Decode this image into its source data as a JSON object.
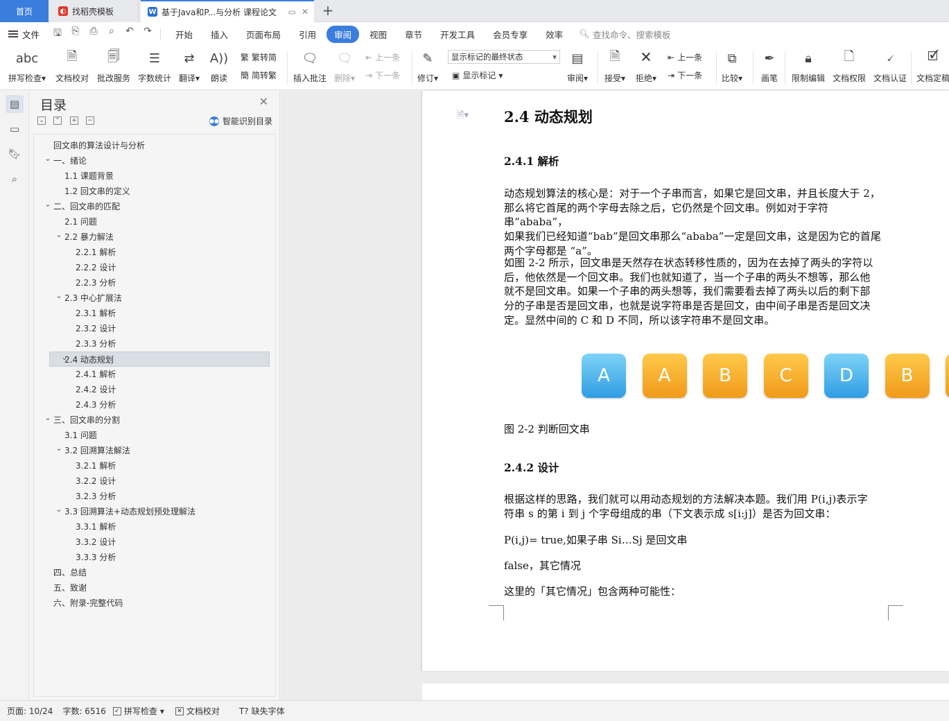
{
  "tabs": {
    "home": "首页",
    "templates": "找稻壳模板",
    "document": "基于Java和P...与分析 课程论文"
  },
  "menu": {
    "file": "文件",
    "items": [
      "开始",
      "插入",
      "页面布局",
      "引用",
      "审阅",
      "视图",
      "章节",
      "开发工具",
      "会员专享",
      "效率"
    ],
    "active": "审阅",
    "search": "查找命令、搜索模板"
  },
  "ribbon": {
    "spellcheck": "拼写检查",
    "doc_check": "文档校对",
    "revision_service": "批改服务",
    "word_count": "字数统计",
    "translate": "翻译",
    "read_aloud": "朗读",
    "to_traditional": "繁转简",
    "to_simplified": "简转繁",
    "insert_comment": "插入批注",
    "delete": "删除",
    "prev_comment": "上一条",
    "next_comment": "下一条",
    "track_changes": "修订",
    "markup_state": "显示标记的最终状态",
    "show_markup": "显示标记",
    "review": "审阅",
    "accept": "接受",
    "reject": "拒绝",
    "prev_change": "上一条",
    "next_change": "下一条",
    "compare": "比较",
    "pen": "画笔",
    "restrict_edit": "限制编辑",
    "doc_permission": "文档权限",
    "doc_certify": "文档认证",
    "doc_finalize": "文档定稿"
  },
  "toc": {
    "title": "目录",
    "smart": "智能识别目录",
    "items": [
      {
        "label": "回文串的算法设计与分析",
        "level": 0,
        "chev": false
      },
      {
        "label": "一、绪论",
        "level": 0,
        "chev": true
      },
      {
        "label": "1.1  课题背景",
        "level": 1,
        "chev": false
      },
      {
        "label": "1.2  回文串的定义",
        "level": 1,
        "chev": false
      },
      {
        "label": "二、回文串的匹配",
        "level": 0,
        "chev": true
      },
      {
        "label": "2.1  问题",
        "level": 1,
        "chev": false
      },
      {
        "label": "2.2  暴力解法",
        "level": 1,
        "chev": true
      },
      {
        "label": "2.2.1  解析",
        "level": 2,
        "chev": false
      },
      {
        "label": "2.2.2  设计",
        "level": 2,
        "chev": false
      },
      {
        "label": "2.2.3  分析",
        "level": 2,
        "chev": false
      },
      {
        "label": "2.3  中心扩展法",
        "level": 1,
        "chev": true
      },
      {
        "label": "2.3.1  解析",
        "level": 2,
        "chev": false
      },
      {
        "label": "2.3.2  设计",
        "level": 2,
        "chev": false
      },
      {
        "label": "2.3.3  分析",
        "level": 2,
        "chev": false
      },
      {
        "label": "2.4  动态规划",
        "level": 1,
        "chev": true,
        "selected": true
      },
      {
        "label": "2.4.1  解析",
        "level": 2,
        "chev": false
      },
      {
        "label": "2.4.2  设计",
        "level": 2,
        "chev": false
      },
      {
        "label": "2.4.3  分析",
        "level": 2,
        "chev": false
      },
      {
        "label": "三、回文串的分割",
        "level": 0,
        "chev": true
      },
      {
        "label": "3.1  问题",
        "level": 1,
        "chev": false
      },
      {
        "label": "3.2  回溯算法解法",
        "level": 1,
        "chev": true
      },
      {
        "label": "3.2.1  解析",
        "level": 2,
        "chev": false
      },
      {
        "label": "3.2.2  设计",
        "level": 2,
        "chev": false
      },
      {
        "label": "3.2.3  分析",
        "level": 2,
        "chev": false
      },
      {
        "label": "3.3  回溯算法+动态规划预处理解法",
        "level": 1,
        "chev": true
      },
      {
        "label": "3.3.1  解析",
        "level": 2,
        "chev": false
      },
      {
        "label": "3.3.2  设计",
        "level": 2,
        "chev": false
      },
      {
        "label": "3.3.3  分析",
        "level": 2,
        "chev": false
      },
      {
        "label": "四、总结",
        "level": 0,
        "chev": false
      },
      {
        "label": "五、致谢",
        "level": 0,
        "chev": false
      },
      {
        "label": "六、附录-完整代码",
        "level": 0,
        "chev": false
      }
    ]
  },
  "document": {
    "h24": "2.4  动态规划",
    "h241": "2.4.1  解析",
    "p1": [
      "动态规划算法的核心是：对于一个子串而言，如果它是回文串，并且长度大于 2，",
      "那么将它首尾的两个字母去除之后，它仍然是个回文串。例如对于字符串“ababa”，",
      "如果我们已经知道“bab”是回文串那么“ababa”一定是回文串，这是因为它的首尾",
      "两个字母都是 “a”。"
    ],
    "p2": [
      "如图 2-2 所示，回文串是天然存在状态转移性质的，因为在去掉了两头的字符以",
      "后，他依然是一个回文串。我们也就知道了，当一个子串的两头不想等，那么他",
      "就不是回文串。如果一个子串的两头想等，我们需要看去掉了两头以后的剩下部",
      "分的子串是否是回文串，也就是说字符串是否是回文，由中间子串是否是回文决",
      "定。显然中间的 C 和 D 不同，所以该字符串不是回文串。"
    ],
    "letters": [
      {
        "ch": "A",
        "color": "blue"
      },
      {
        "ch": "A",
        "color": "orange"
      },
      {
        "ch": "B",
        "color": "orange"
      },
      {
        "ch": "C",
        "color": "orange"
      },
      {
        "ch": "D",
        "color": "blue"
      },
      {
        "ch": "B",
        "color": "orange"
      },
      {
        "ch": "",
        "color": "orange"
      }
    ],
    "caption": "图 2-2  判断回文串",
    "h242": "2.4.2  设计",
    "p3": [
      "根据这样的思路，我们就可以用动态规划的方法解决本题。我们用 P(i,j)表示字",
      "符串 s 的第 i 到 j 个字母组成的串（下文表示成 s[i:j]）是否为回文串："
    ],
    "p4": "P(i,j)= true,如果子串 Si…Sj 是回文串",
    "p5": "false，其它情况",
    "p6": "这里的「其它情况」包含两种可能性："
  },
  "status": {
    "page": "页面: 10/24",
    "words": "字数: 6516",
    "spell": "拼写检查",
    "proof": "文档校对",
    "missing_font": "缺失字体"
  }
}
